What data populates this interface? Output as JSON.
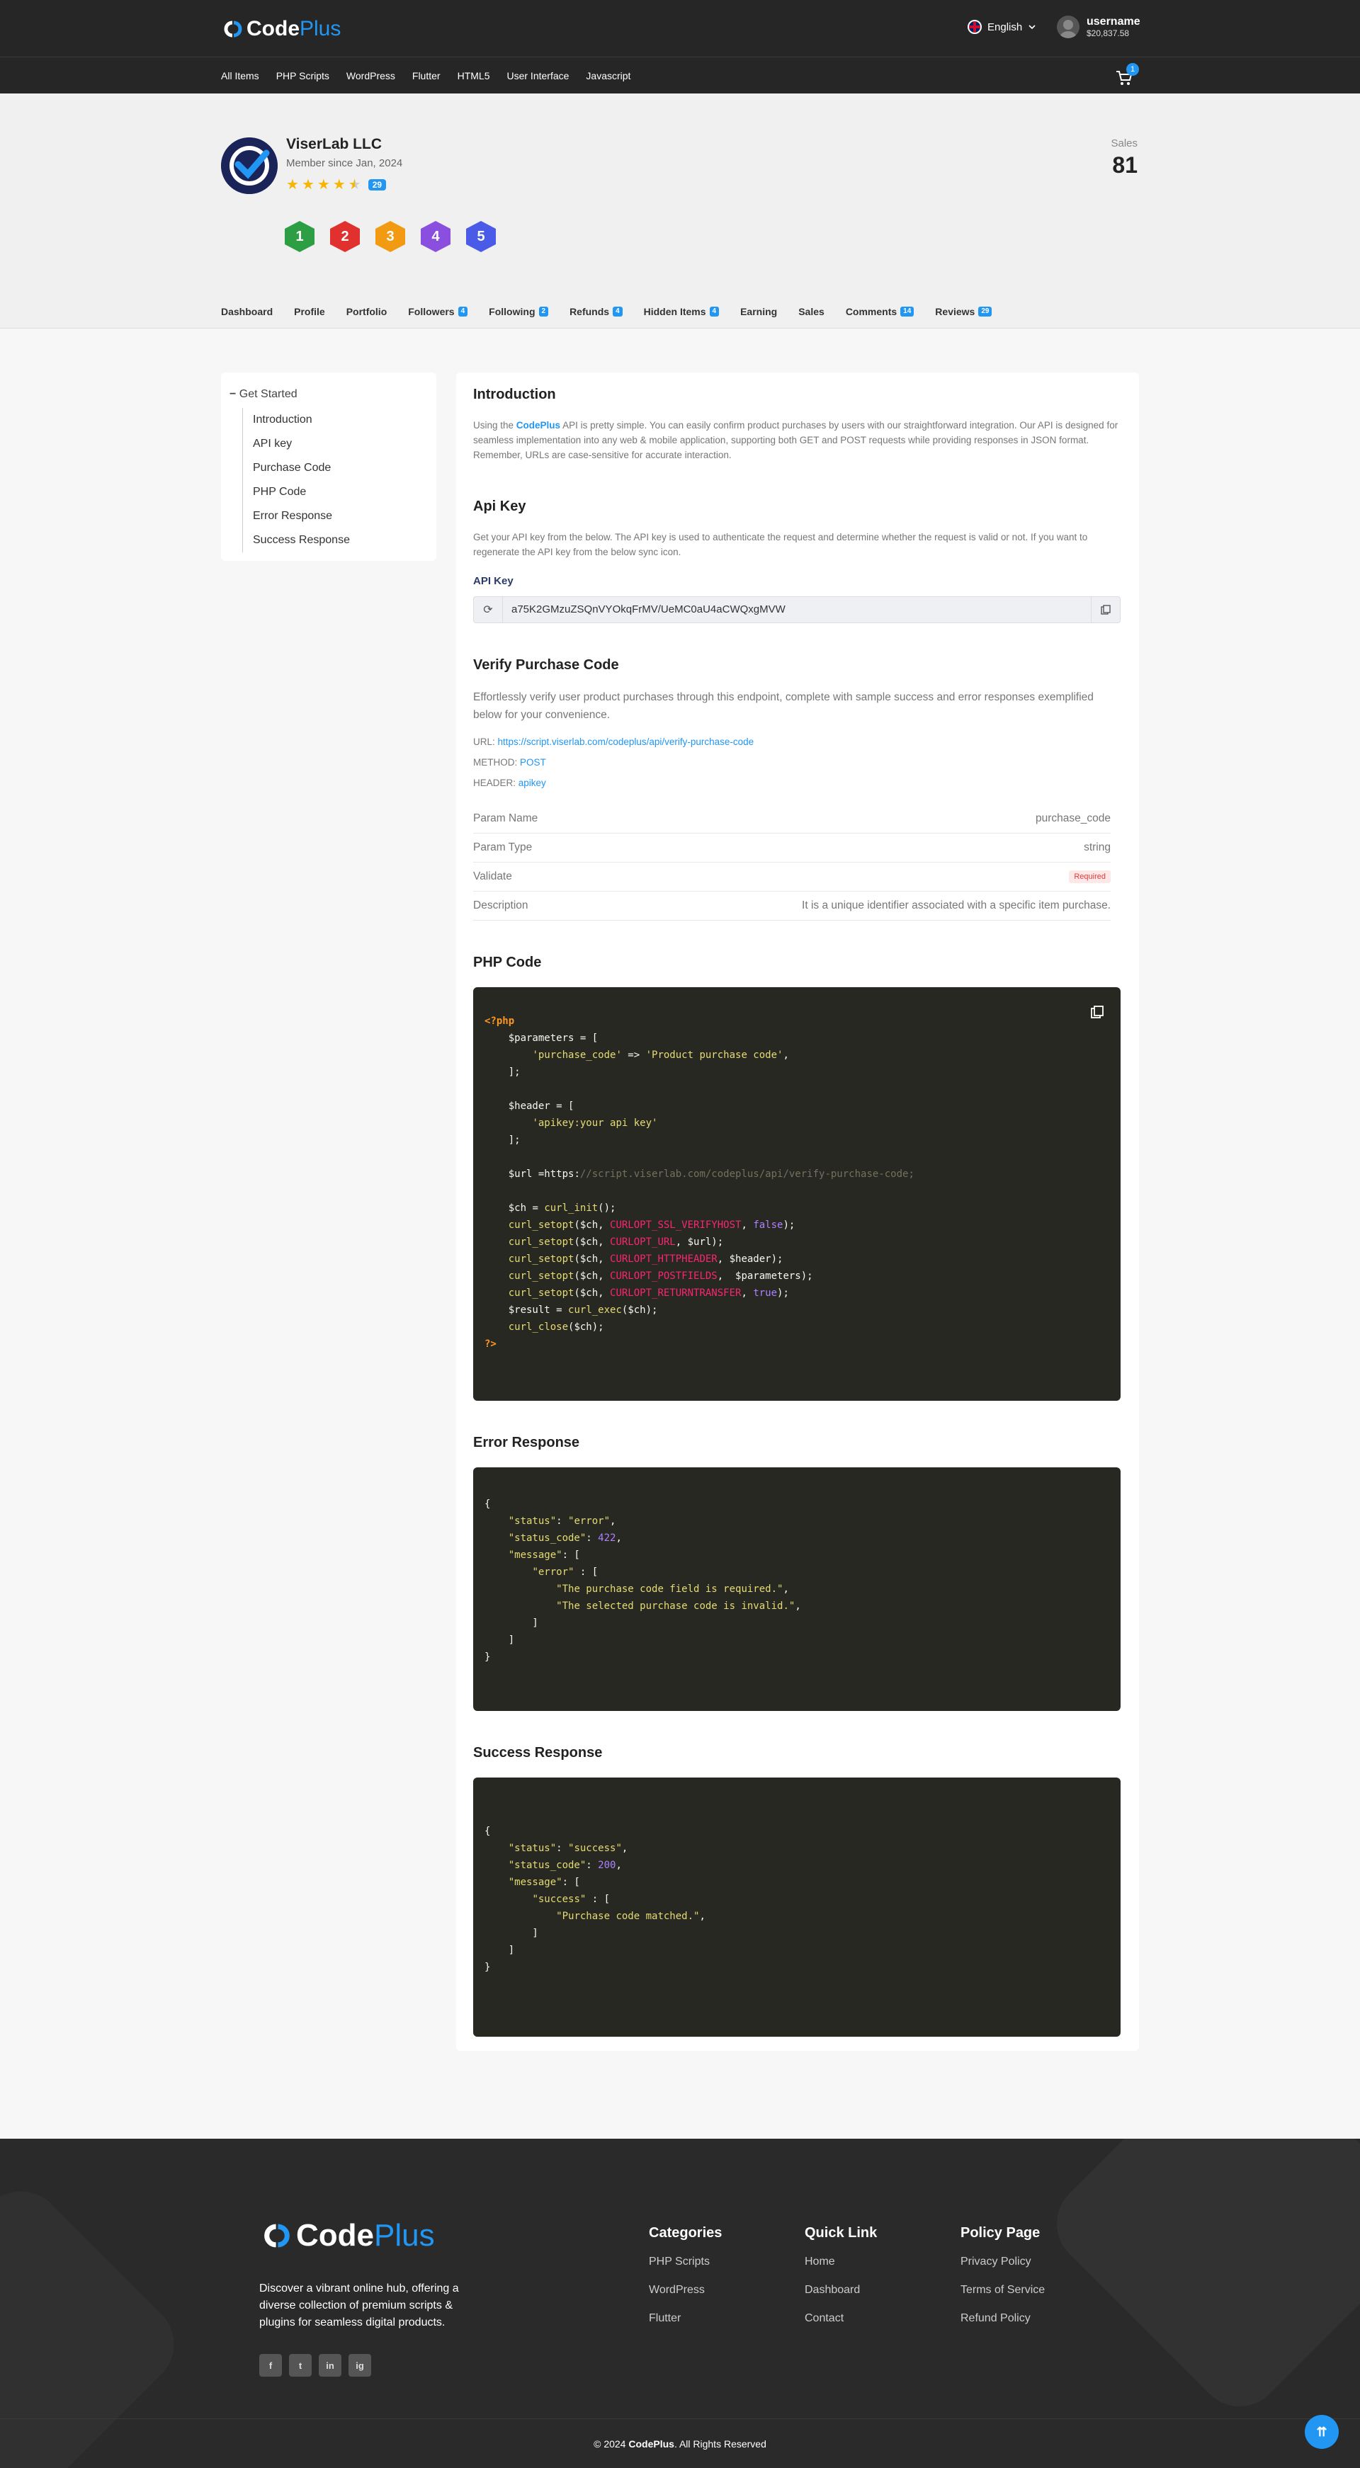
{
  "header": {
    "logo": {
      "word1": "Code",
      "word2": "Plus"
    },
    "language": "English",
    "username": "username",
    "balance": "$20,837.58",
    "cart_count": "1"
  },
  "nav": {
    "items": [
      "All Items",
      "PHP Scripts",
      "WordPress",
      "Flutter",
      "HTML5",
      "User Interface",
      "Javascript"
    ]
  },
  "profile": {
    "name": "ViserLab LLC",
    "member_since": "Member since Jan, 2024",
    "rating": 4.5,
    "rating_count": "29",
    "levels": [
      "1",
      "2",
      "3",
      "4",
      "5"
    ],
    "level_colors": [
      "#2e9e45",
      "#e0312f",
      "#f19a12",
      "#8b4fe0",
      "#4a5be8"
    ],
    "sales_label": "Sales",
    "sales_value": "81",
    "tabs": [
      {
        "label": "Dashboard",
        "count": ""
      },
      {
        "label": "Profile",
        "count": ""
      },
      {
        "label": "Portfolio",
        "count": ""
      },
      {
        "label": "Followers",
        "count": "4"
      },
      {
        "label": "Following",
        "count": "2"
      },
      {
        "label": "Refunds",
        "count": "4"
      },
      {
        "label": "Hidden Items",
        "count": "4"
      },
      {
        "label": "Earning",
        "count": ""
      },
      {
        "label": "Sales",
        "count": ""
      },
      {
        "label": "Comments",
        "count": "14"
      },
      {
        "label": "Reviews",
        "count": "29"
      }
    ]
  },
  "sidebar": {
    "heading": "Get Started",
    "items": [
      "Introduction",
      "API key",
      "Purchase Code",
      "PHP Code",
      "Error Response",
      "Success Response"
    ]
  },
  "intro": {
    "title": "Introduction",
    "text_before": "Using the ",
    "brand": "CodePlus",
    "text_after": " API is pretty simple. You can easily confirm product purchases by users with our straightforward integration. Our API is designed for seamless implementation into any web & mobile application, supporting both GET and POST requests while providing responses in JSON format. Remember, URLs are case-sensitive for accurate interaction."
  },
  "apikey": {
    "title": "Api Key",
    "text": "Get your API key from the below. The API key is used to authenticate the request and determine whether the request is valid or not. If you want to regenerate the API key from the below sync icon.",
    "label": "API Key",
    "value": "a75K2GMzuZSQnVYOkqFrMV/UeMC0aU4aCWQxgMVW"
  },
  "verify": {
    "title": "Verify Purchase Code",
    "text": "Effortlessly verify user product purchases through this endpoint, complete with sample success and error responses exemplified below for your convenience.",
    "url_label": "URL: ",
    "url": "https://script.viserlab.com/codeplus/api/verify-purchase-code",
    "method_label": "METHOD: ",
    "method": "POST",
    "header_label": "HEADER: ",
    "header": "apikey",
    "params": [
      {
        "name": "Param Name",
        "value": "purchase_code"
      },
      {
        "name": "Param Type",
        "value": "string"
      },
      {
        "name": "Validate",
        "value": "Required"
      },
      {
        "name": "Description",
        "value": "It is a unique identifier associated with a specific item purchase."
      }
    ]
  },
  "php": {
    "title": "PHP Code"
  },
  "error": {
    "title": "Error Response"
  },
  "success": {
    "title": "Success Response"
  },
  "footer": {
    "description": "Discover a vibrant online hub, offering a diverse collection of premium scripts & plugins for seamless digital products.",
    "social": [
      "f",
      "t",
      "in",
      "ig"
    ],
    "columns": [
      {
        "title": "Categories",
        "links": [
          "PHP Scripts",
          "WordPress",
          "Flutter"
        ]
      },
      {
        "title": "Quick Link",
        "links": [
          "Home",
          "Dashboard",
          "Contact"
        ]
      },
      {
        "title": "Policy Page",
        "links": [
          "Privacy Policy",
          "Terms of Service",
          "Refund Policy"
        ]
      }
    ],
    "copyright_prefix": "© 2024 ",
    "copyright_brand": "CodePlus",
    "copyright_suffix": ". All Rights Reserved"
  }
}
